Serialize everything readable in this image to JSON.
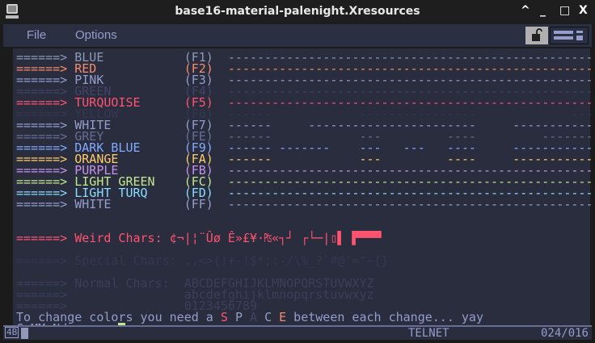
{
  "window": {
    "title": "base16-material-palenight.Xresources",
    "controls": [
      "^",
      "_",
      "□",
      "X"
    ]
  },
  "menu": {
    "file": "File",
    "options": "Options"
  },
  "colors": {
    "bg": "#292d3e"
  },
  "arrow": "======>",
  "color_rows": [
    {
      "label": "BLUE",
      "code": "(F1)",
      "color": "#8e9ab8",
      "dashes": "---------------------------------------------------"
    },
    {
      "label": "RED",
      "code": "(F2)",
      "color": "#f78c6c",
      "dashes": "---------------------------------------------------"
    },
    {
      "label": "PINK",
      "code": "(F3)",
      "color": "#959dcb",
      "dashes": "---------------------------------------------------"
    },
    {
      "label": "GREEN",
      "code": "(F4)",
      "color": "#444267",
      "dashes": "---------------------------------------------------"
    },
    {
      "label": "TURQUOISE",
      "code": "(F5)",
      "color": "#ff5370",
      "dashes": "---------------------------------------------------"
    },
    {
      "label": "YELLOW",
      "code": "(F6)",
      "color": "#343850",
      "dashes": "------            ----------------             ----"
    },
    {
      "label": "WHITE",
      "code": "(F7)",
      "color": "#959dcb",
      "dashes": "------     -----------------------     ------------"
    },
    {
      "label": "GREY",
      "code": "(FE)",
      "color": "#676e95",
      "dashes": "------            ---         ----         --------"
    },
    {
      "label": "DARK BLUE",
      "code": "(F9)",
      "color": "#82aaff",
      "dashes": "------ -------    ---   ---   ----     ------------"
    },
    {
      "label": "ORANGE",
      "code": "(FA)",
      "color": "#ffcb6b",
      "dashes": "------            ---         ----     ------------"
    },
    {
      "label": "PURPLE",
      "code": "(FB)",
      "color": "#c792ea",
      "dashes": "---------------------------------------------------"
    },
    {
      "label": "LIGHT GREEN",
      "code": "(FC)",
      "color": "#c3e88d",
      "dashes": "---------------------------------------------------"
    },
    {
      "label": "LIGHT TURQ",
      "code": "(FD)",
      "color": "#89ddff",
      "dashes": "---------------------------------------------------"
    },
    {
      "label": "WHITE",
      "code": "(FF)",
      "color": "#959dcb",
      "dashes": "---------------------------------------------------"
    }
  ],
  "weird": {
    "label": "Weird Chars:",
    "chars": "¢¬|¦¨Ûø Ê»£¥·₧«┐┘ ┌└─|▯▌ ▛▀▀▀"
  },
  "special": {
    "label": "Special Chars:",
    "chars": ".,<>()+-!$*;:-/\\%_?`#@'=\"~{}"
  },
  "normal": {
    "label": "Normal Chars:",
    "upper": "ABCDEFGHIJKLMNOPQRSTUVWXYZ",
    "lower": "abcdefghijklmnopqrstuvwxyz",
    "digits": "0123456789"
  },
  "hint": {
    "pre": "To change colors you need a ",
    "s": "S",
    "p": "P",
    "a": "A",
    "c": "C",
    "e": "E",
    "post": " between each change... yay"
  },
  "prompt": "CoMMaNd ===>",
  "status": {
    "indicator": "4B",
    "mode": "TELNET",
    "position": "024/016"
  }
}
